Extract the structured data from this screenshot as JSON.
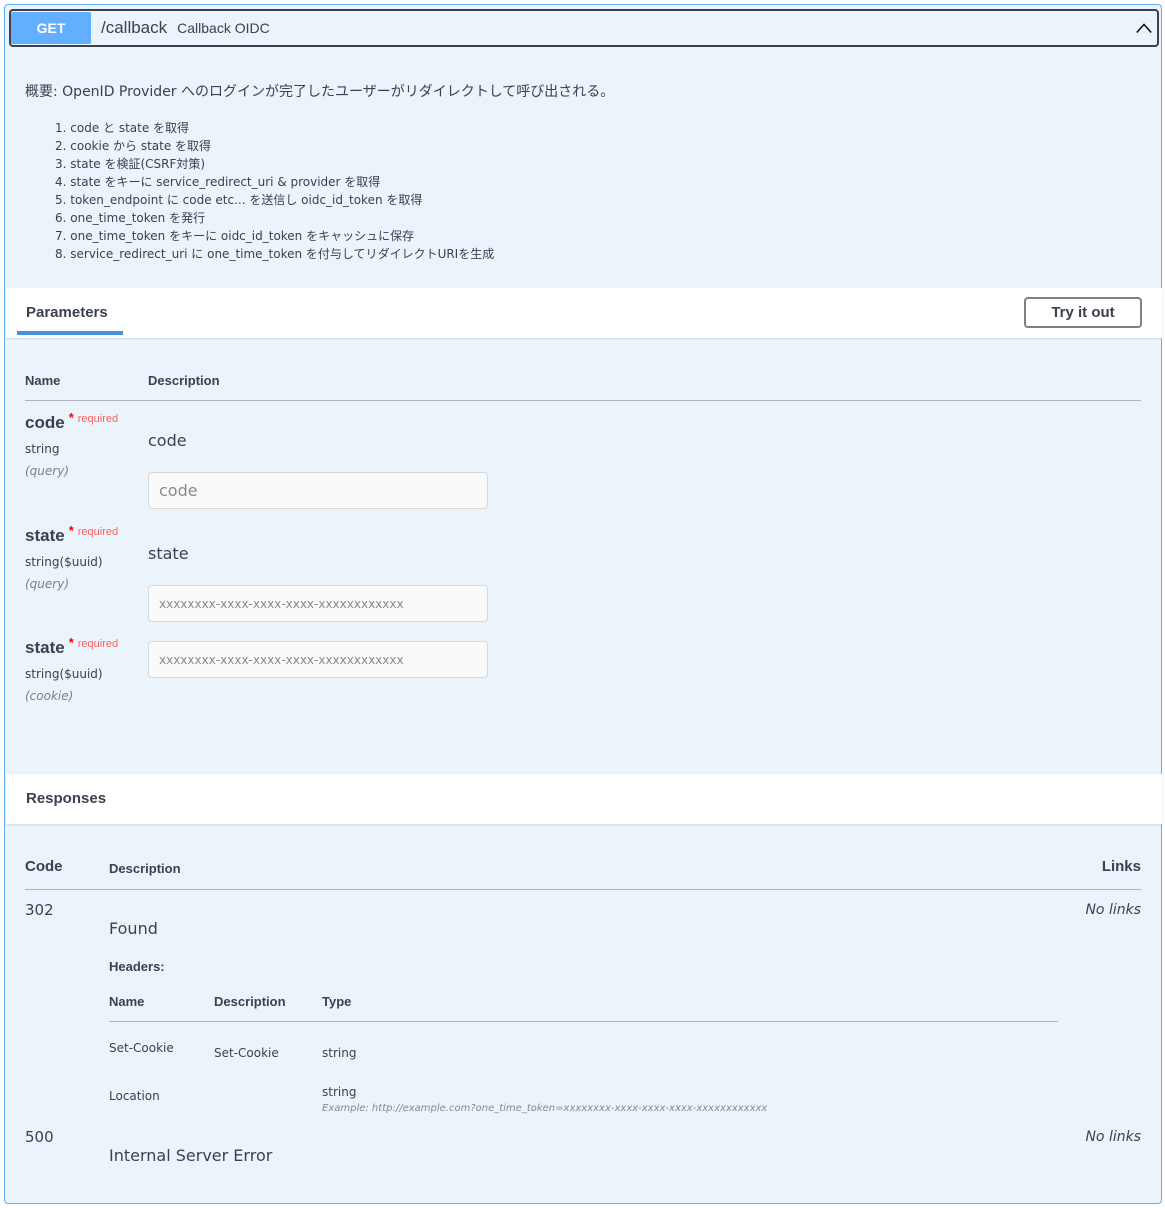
{
  "operation": {
    "method": "GET",
    "path": "/callback",
    "summary": "Callback OIDC"
  },
  "description": {
    "intro": "概要: OpenID Provider へのログインが完了したユーザーがリダイレクトして呼び出される。",
    "steps": [
      "1. code と state を取得",
      "2. cookie から state を取得",
      "3. state を検証(CSRF対策)",
      "4. state をキーに service_redirect_uri & provider を取得",
      "5. token_endpoint に code etc... を送信し oidc_id_token を取得",
      "6. one_time_token を発行",
      "7. one_time_token をキーに oidc_id_token をキャッシュに保存",
      "8. service_redirect_uri に one_time_token を付与してリダイレクトURIを生成"
    ]
  },
  "parameters": {
    "tab_label": "Parameters",
    "try_button": "Try it out",
    "col_name": "Name",
    "col_description": "Description",
    "required_star": "*",
    "required_text": "required",
    "items": [
      {
        "name": "code",
        "type": "string",
        "in": "(query)",
        "description": "code",
        "placeholder": "code"
      },
      {
        "name": "state",
        "type": "string($uuid)",
        "in": "(query)",
        "description": "state",
        "placeholder": "xxxxxxxx-xxxx-xxxx-xxxx-xxxxxxxxxxxx"
      },
      {
        "name": "state",
        "type": "string($uuid)",
        "in": "(cookie)",
        "description": "",
        "placeholder": "xxxxxxxx-xxxx-xxxx-xxxx-xxxxxxxxxxxx"
      }
    ]
  },
  "responses": {
    "title": "Responses",
    "col_code": "Code",
    "col_description": "Description",
    "col_links": "Links",
    "items": [
      {
        "code": "302",
        "description": "Found",
        "links": "No links",
        "headers_label": "Headers:",
        "headers_cols": [
          "Name",
          "Description",
          "Type"
        ],
        "headers": [
          {
            "name": "Set-Cookie",
            "description": "Set-Cookie",
            "type": "string",
            "example": ""
          },
          {
            "name": "Location",
            "description": "",
            "type": "string",
            "example": "Example: http://example.com?one_time_token=xxxxxxxx-xxxx-xxxx-xxxx-xxxxxxxxxxxx"
          }
        ]
      },
      {
        "code": "500",
        "description": "Internal Server Error",
        "links": "No links"
      }
    ]
  },
  "colors": {
    "get_accent": "#61affe",
    "block_bg": "#ebf3fb",
    "tab_underline": "#4990e2",
    "required": "#ff0000"
  },
  "icons": {
    "collapse": "chevron-up-icon"
  }
}
